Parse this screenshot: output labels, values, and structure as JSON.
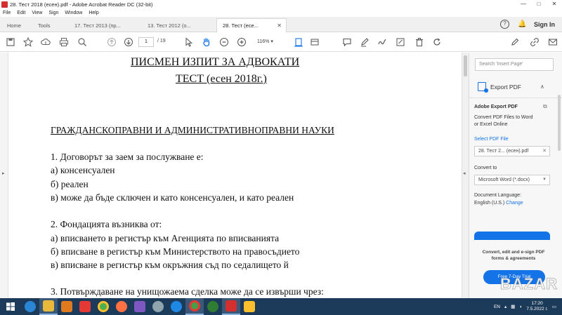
{
  "window": {
    "title": "28. Тест 2018 (есен).pdf - Adobe Acrobat Reader DC (32-bit)",
    "controls": [
      "—",
      "□",
      "✕"
    ]
  },
  "menu": [
    "File",
    "Edit",
    "View",
    "Sign",
    "Window",
    "Help"
  ],
  "tabs": [
    {
      "label": "Home"
    },
    {
      "label": "Tools"
    },
    {
      "label": "17. Тест 2013 (пр..."
    },
    {
      "label": "13. Тест 2012 (о..."
    },
    {
      "label": "28. Тест (есе...",
      "active": true,
      "close": "✕"
    }
  ],
  "header_right": {
    "signin": "Sign In",
    "help": "?"
  },
  "toolbar": {
    "page_current": "1",
    "page_count": "/ 19",
    "zoom": "116%"
  },
  "document": {
    "title_line1": "ПИСМЕН ИЗПИТ ЗА АДВОКАТИ",
    "title_line2": "ТЕСТ (есен 2018г.)",
    "section": "ГРАЖДАНСКОПРАВНИ И АДМИНИСТРАТИВНОПРАВНИ НАУКИ",
    "lines": [
      "1. Договорът за заем за послужване е:",
      "а) консенсуален",
      "б) реален",
      "в) може да бъде сключен и като консенсуален, и като реален",
      "2. Фондацията възниква от:",
      "а) вписването в регистър към Агенцията по вписванията",
      "б) вписване в регистър към Министерството на правосъдието",
      "в) вписване в регистър към окръжния съд по седалището й",
      "3. Потвърждаване на унищожаема сделка може да се извърши чрез:"
    ]
  },
  "right_pane": {
    "search_placeholder": "Search 'Insert Page'",
    "export_title": "Export PDF",
    "adobe_export": "Adobe Export PDF",
    "convert_desc1": "Convert PDF Files to Word",
    "convert_desc2": "or Excel Online",
    "select_file": "Select PDF File",
    "file_name": "28. Тест 2... (есен).pdf",
    "convert_to": "Convert to",
    "format": "Microsoft Word (*.docx)",
    "doc_lang": "Document Language:",
    "lang": "English (U.S.)",
    "change": "Change",
    "promo1": "Convert, edit and e-sign PDF",
    "promo2": "forms & agreements",
    "trial": "Free 7-Day Trial"
  },
  "taskbar": {
    "lang": "EN",
    "time": "17:20",
    "date": "7.5.2022 г."
  },
  "watermark": "BAZAR",
  "colors": {
    "accent": "#1473e6",
    "taskbar": "#1c3b5a"
  }
}
